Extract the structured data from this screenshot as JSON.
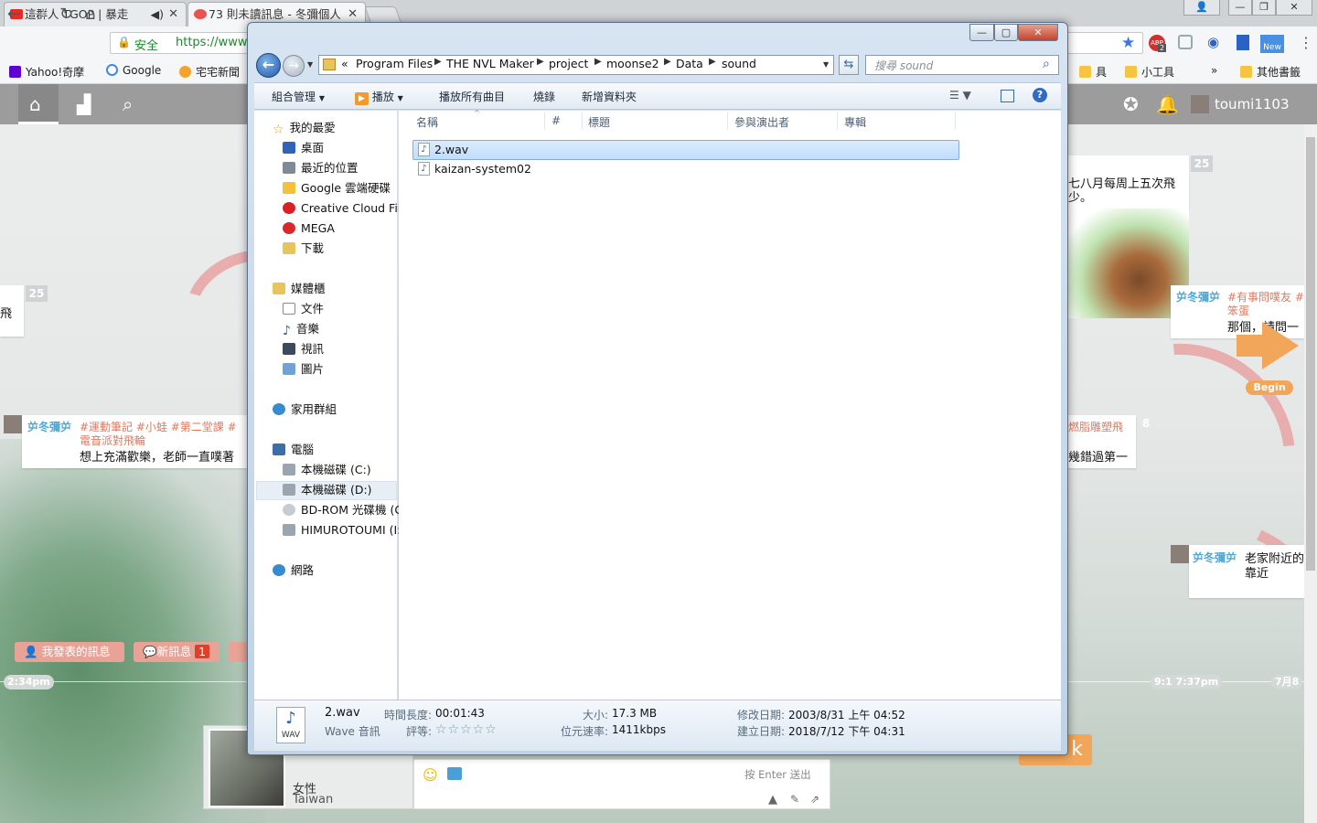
{
  "browser": {
    "tabs": [
      {
        "label": "這群人 TGOP | 暴走"
      },
      {
        "label": "73 則未讀訊息 - 冬彌個人"
      }
    ],
    "security_label": "安全",
    "url": "https://www",
    "bookmarks": [
      "Yahoo!奇摩",
      "Google",
      "宅宅新聞"
    ],
    "bookmarks_right": [
      "具",
      "小工具",
      "其他書籤"
    ],
    "bookmarks_more": "»",
    "ext_badge": "2",
    "ext_new": "New"
  },
  "site": {
    "user": "toumi1103",
    "cards": [
      {
        "badge": "25"
      },
      {
        "badge": "25"
      },
      {
        "badge": "8"
      }
    ],
    "post_left": {
      "nick": "屰冬彌屰",
      "tags": "#運動筆記  #小蛙  #第二堂課  #",
      "tags2": "電音派對飛輪",
      "text": "想上充滿歡樂，老師一直噗著"
    },
    "post_top_right": {
      "text1": "七八月每周上五次飛",
      "text2": "少。"
    },
    "post_mid_right": {
      "nick": "屰冬彌屰",
      "tags": "#有事問噗友  #",
      "tags2": "笨蛋",
      "text": "那個，請問一"
    },
    "post_right_2": {
      "tag": "燃脂雕塑飛",
      "text": "幾錯過第一"
    },
    "post_bottom_right": {
      "nick": "屰冬彌屰",
      "text1": "老家附近的",
      "text2": "靠近"
    },
    "left_stub": "飛",
    "begin": "Begin",
    "buttons": {
      "my_posts": "我發表的訊息",
      "new_msg": "新訊息",
      "new_count": "1"
    },
    "times": [
      "2:34pm",
      "9:1 7:37pm",
      "7月8"
    ],
    "profile": {
      "gender": "女性",
      "location": "Taiwan"
    },
    "chat_hint": "按 Enter 送出",
    "go_label": "k"
  },
  "explorer": {
    "breadcrumb": [
      "«",
      "Program Files",
      "THE NVL Maker",
      "project",
      "moonse2",
      "Data",
      "sound"
    ],
    "search_placeholder": "搜尋 sound",
    "commands": [
      "組合管理",
      "播放",
      "播放所有曲目",
      "燒錄",
      "新增資料夾"
    ],
    "columns": [
      "名稱",
      "#",
      "標題",
      "參與演出者",
      "專輯"
    ],
    "files": [
      {
        "name": "2.wav",
        "selected": true
      },
      {
        "name": "kaizan-system02",
        "selected": false
      }
    ],
    "nav": {
      "favorites": {
        "label": "我的最愛",
        "items": [
          "桌面",
          "最近的位置",
          "Google 雲端硬碟",
          "Creative Cloud File",
          "MEGA",
          "下載"
        ]
      },
      "libraries": {
        "label": "媒體櫃",
        "items": [
          "文件",
          "音樂",
          "視訊",
          "圖片"
        ]
      },
      "homegroup": "家用群組",
      "computer": {
        "label": "電腦",
        "items": [
          "本機磁碟 (C:)",
          "本機磁碟 (D:)",
          "BD-ROM 光碟機 (G",
          "HIMUROTOUMI (I:"
        ]
      },
      "network": "網路"
    },
    "details": {
      "name": "2.wav",
      "type": "Wave 音訊",
      "icon_text": "WAV",
      "duration_label": "時間長度:",
      "duration": "00:01:43",
      "rating_label": "評等:",
      "size_label": "大小:",
      "size": "17.3 MB",
      "bitrate_label": "位元速率:",
      "bitrate": "1411kbps",
      "modified_label": "修改日期:",
      "modified": "2003/8/31 上午 04:52",
      "created_label": "建立日期:",
      "created": "2018/7/12 下午 04:31"
    }
  },
  "colors": {
    "plurk_nav": "#9c9c9c",
    "accent_orange": "#f2a65a",
    "selection": "#c1dcfc"
  }
}
